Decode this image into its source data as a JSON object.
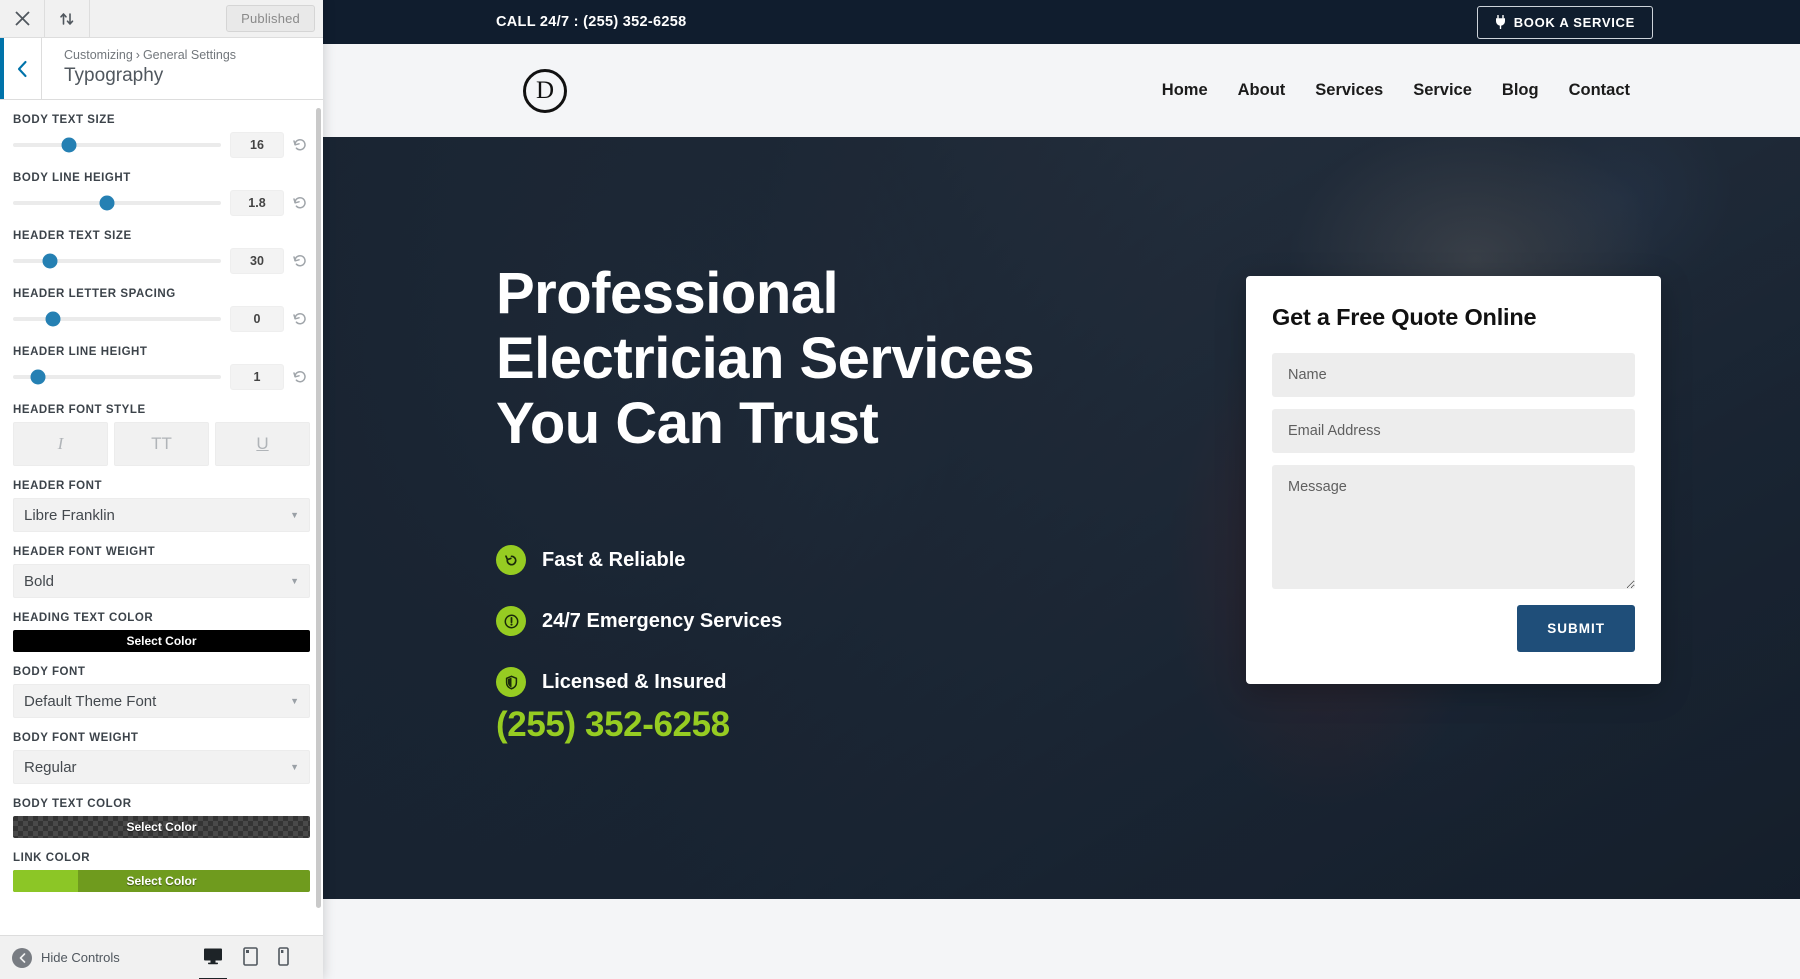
{
  "customizer": {
    "topbar": {
      "close_icon": "close-icon",
      "updown_icon": "expand-collapse-icon",
      "publish_label": "Published"
    },
    "header": {
      "back_icon": "chevron-left-icon",
      "breadcrumb_root": "Customizing",
      "breadcrumb_sep": "›",
      "breadcrumb_parent": "General Settings",
      "section_title": "Typography"
    },
    "sliders": [
      {
        "label": "BODY TEXT SIZE",
        "value": "16",
        "knob_pct": 27,
        "reset_icon": "reset-icon"
      },
      {
        "label": "BODY LINE HEIGHT",
        "value": "1.8",
        "knob_pct": 45,
        "reset_icon": "reset-icon"
      },
      {
        "label": "HEADER TEXT SIZE",
        "value": "30",
        "knob_pct": 18,
        "reset_icon": "reset-icon"
      },
      {
        "label": "HEADER LETTER SPACING",
        "value": "0",
        "knob_pct": 19,
        "reset_icon": "reset-icon"
      },
      {
        "label": "HEADER LINE HEIGHT",
        "value": "1",
        "knob_pct": 12,
        "reset_icon": "reset-icon"
      }
    ],
    "font_style": {
      "label": "HEADER FONT STYLE",
      "buttons": [
        {
          "name": "italic-button",
          "glyph": "I"
        },
        {
          "name": "uppercase-button",
          "glyph": "TT"
        },
        {
          "name": "underline-button",
          "glyph": "U"
        }
      ]
    },
    "fields": [
      {
        "label": "HEADER FONT",
        "value": "Libre Franklin",
        "type": "select"
      },
      {
        "label": "HEADER FONT WEIGHT",
        "value": "Bold",
        "type": "select"
      },
      {
        "label": "HEADING TEXT COLOR",
        "value": "Select Color",
        "type": "color",
        "color": "#000000",
        "alpha": 1
      },
      {
        "label": "BODY FONT",
        "value": "Default Theme Font",
        "type": "select"
      },
      {
        "label": "BODY FONT WEIGHT",
        "value": "Regular",
        "type": "select"
      },
      {
        "label": "BODY TEXT COLOR",
        "value": "Select Color",
        "type": "color",
        "color": "#333333",
        "alpha": 0.85
      },
      {
        "label": "LINK COLOR",
        "value": "Select Color",
        "type": "color",
        "color": "#6f9b1e",
        "alpha": 1,
        "split_color": "#8cc626"
      }
    ],
    "footer": {
      "hide_controls_label": "Hide Controls",
      "collapse_icon": "collapse-left-icon",
      "devices": [
        {
          "name": "desktop-preview-button",
          "icon": "desktop-icon",
          "active": true
        },
        {
          "name": "tablet-preview-button",
          "icon": "tablet-icon",
          "active": false
        },
        {
          "name": "mobile-preview-button",
          "icon": "mobile-icon",
          "active": false
        }
      ]
    }
  },
  "preview": {
    "topbar": {
      "call_text": "CALL 24/7 : (255) 352-6258",
      "book_button": "BOOK A SERVICE",
      "book_icon": "plug-icon",
      "bg_color": "#101d2e"
    },
    "navbar": {
      "logo_letter": "D",
      "logo_name": "divi-logo",
      "menu": [
        {
          "label": "Home"
        },
        {
          "label": "About"
        },
        {
          "label": "Services"
        },
        {
          "label": "Service"
        },
        {
          "label": "Blog"
        },
        {
          "label": "Contact"
        }
      ]
    },
    "hero": {
      "title_lines": [
        "Professional",
        "Electrician Services",
        "You Can Trust"
      ],
      "features": [
        {
          "text": "Fast & Reliable",
          "icon": "history-icon"
        },
        {
          "text": "24/7 Emergency Services",
          "icon": "alert-icon"
        },
        {
          "text": "Licensed & Insured",
          "icon": "shield-icon"
        }
      ],
      "phone": "(255) 352-6258",
      "accent_color": "#96cc22"
    },
    "quote_form": {
      "title": "Get a Free Quote Online",
      "name_placeholder": "Name",
      "email_placeholder": "Email Address",
      "message_placeholder": "Message",
      "submit_label": "SUBMIT",
      "submit_color": "#1f4e79"
    }
  }
}
